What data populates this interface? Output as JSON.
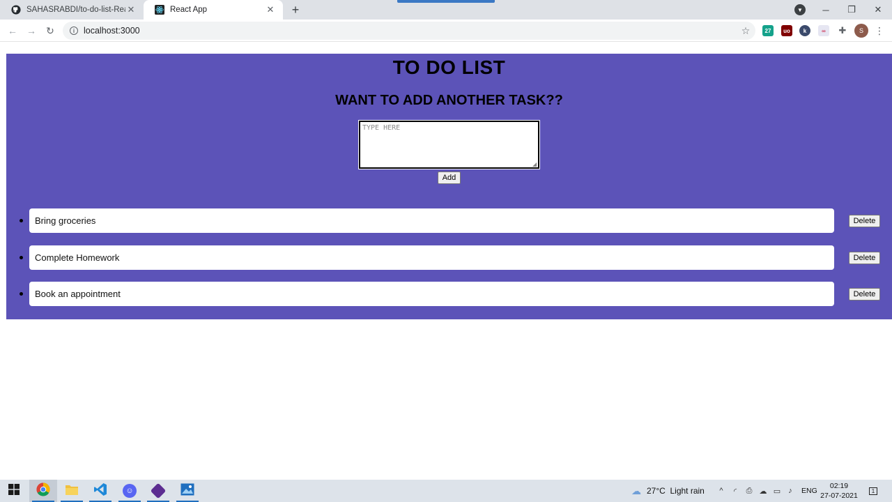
{
  "browser": {
    "tabs": [
      {
        "title": "SAHASRABDI/to-do-list-React",
        "icon": "github-icon"
      },
      {
        "title": "React App",
        "icon": "react-icon"
      }
    ],
    "url": "localhost:3000",
    "profile_initial": "S"
  },
  "app": {
    "title": "TO DO LIST",
    "subtitle": "WANT TO ADD ANOTHER TASK??",
    "input_placeholder": "TYPE HERE",
    "input_value": "",
    "add_label": "Add",
    "background_color": "#5c53b8",
    "tasks": [
      {
        "text": "Bring groceries",
        "delete_label": "Delete"
      },
      {
        "text": "Complete Homework",
        "delete_label": "Delete"
      },
      {
        "text": "Book an appointment",
        "delete_label": "Delete"
      }
    ]
  },
  "taskbar": {
    "weather": "27°C  Light rain",
    "language": "ENG",
    "time": "02:19",
    "date": "27-07-2021",
    "notification_count": "1"
  }
}
